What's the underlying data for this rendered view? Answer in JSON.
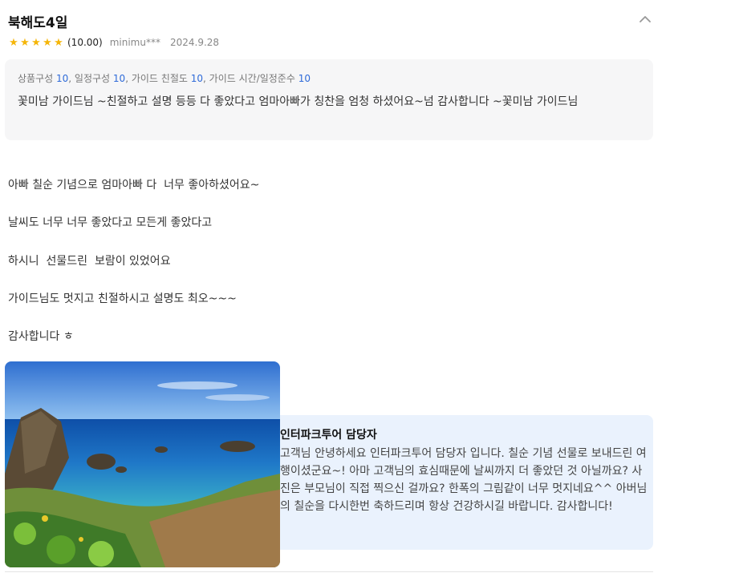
{
  "review": {
    "title": "북해도4일",
    "score": "(10.00)",
    "user": "minimu***",
    "date": "2024.9.28",
    "stars": 5
  },
  "summary": {
    "ratings": [
      {
        "label": "상품구성",
        "value": "10"
      },
      {
        "label": "일정구성",
        "value": "10"
      },
      {
        "label": "가이드 친절도",
        "value": "10"
      },
      {
        "label": "가이드 시간/일정준수",
        "value": "10"
      }
    ],
    "text": "꽃미남 가이드님 ~친절하고 설명 등등 다 좋았다고 엄마아빠가 칭찬을 엄청 하셨어요~넘 감사합니다 ~꽃미남 가이드님"
  },
  "body": {
    "line1": "아빠 칠순 기념으로 엄마아빠 다  너무 좋아하셨어요~",
    "line2": "날씨도 너무 너무 좋았다고 모든게 좋았다고",
    "line3": "하시니  선물드린  보람이 있었어요",
    "line4": "가이드님도 멋지고 친절하시고 설명도 최오~~~",
    "line5": "감사합니다 ㅎ"
  },
  "reply": {
    "name": "인터파크투어 담당자",
    "text": "고객님 안녕하세요 인터파크투어 담당자 입니다. 칠순 기념 선물로 보내드린 여행이셨군요~! 아마 고객님의 효심때문에 날씨까지 더 좋았던 것 아닐까요? 사진은 부모님이 직접 찍으신 걸까요? 한폭의 그림같이 너무 멋지네요^^ 아버님의 칠순을 다시한번 축하드리며 항상 건강하시길 바랍니다. 감사합니다!"
  },
  "colors": {
    "star": "#f5b60a",
    "rating_value": "#2f6bd9",
    "summary_bg": "#f6f6f7",
    "reply_bg": "#eaf2fd"
  }
}
